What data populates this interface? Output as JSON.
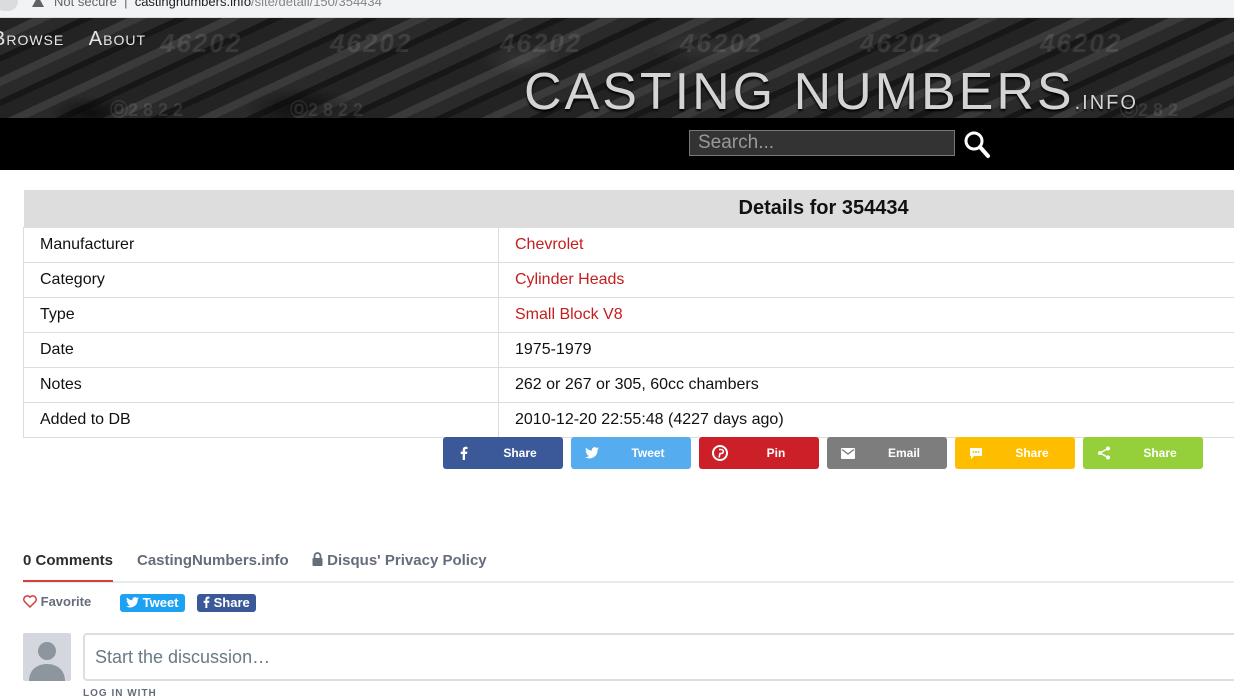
{
  "browser": {
    "security_label": "Not secure",
    "host": "castingnumbers.info",
    "path": "/site/detail/150/354434"
  },
  "site": {
    "nav": [
      "Browse",
      "About"
    ],
    "logo_main": "CASTING NUMBERS",
    "logo_suffix": ".INFO",
    "search_placeholder": "Search..."
  },
  "details": {
    "title": "Details for 354434",
    "rows": [
      {
        "key": "Manufacturer",
        "value": "Chevrolet",
        "link": true
      },
      {
        "key": "Category",
        "value": "Cylinder Heads",
        "link": true
      },
      {
        "key": "Type",
        "value": "Small Block V8",
        "link": true
      },
      {
        "key": "Date",
        "value": "1975-1979",
        "link": false
      },
      {
        "key": "Notes",
        "value": "262 or 267 or 305, 60cc chambers",
        "link": false
      },
      {
        "key": "Added to DB",
        "value": "2010-12-20 22:55:48 (4227 days ago)",
        "link": false
      }
    ]
  },
  "share_buttons": [
    {
      "label": "Share",
      "icon": "facebook-icon",
      "color": "#3b5998"
    },
    {
      "label": "Tweet",
      "icon": "twitter-icon",
      "color": "#55acee"
    },
    {
      "label": "Pin",
      "icon": "pinterest-icon",
      "color": "#cb2027"
    },
    {
      "label": "Email",
      "icon": "email-icon",
      "color": "#7d7d7d"
    },
    {
      "label": "Share",
      "icon": "sms-icon",
      "color": "#ffbd00"
    },
    {
      "label": "Share",
      "icon": "share-icon",
      "color": "#95d03a"
    }
  ],
  "disqus": {
    "comments_tab": "0 Comments",
    "site_tab": "CastingNumbers.info",
    "privacy_tab": "Disqus' Privacy Policy",
    "favorite": "Favorite",
    "tweet": "Tweet",
    "share": "Share",
    "compose_placeholder": "Start the discussion…",
    "login_with": "LOG IN WITH"
  },
  "colors": {
    "link_red": "#c41e1e",
    "disqus_active": "#d43f3a",
    "disqus_tweet": "#1da1f2",
    "disqus_share": "#3b5998"
  }
}
